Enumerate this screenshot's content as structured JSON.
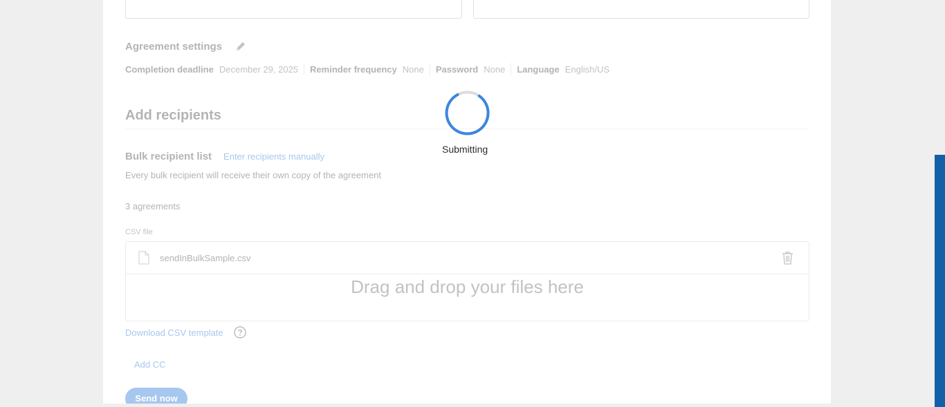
{
  "agreement_settings": {
    "title": "Agreement settings",
    "items": [
      {
        "key": "Completion deadline",
        "value": "December 29, 2025"
      },
      {
        "key": "Reminder frequency",
        "value": "None"
      },
      {
        "key": "Password",
        "value": "None"
      },
      {
        "key": "Language",
        "value": "English/US"
      }
    ]
  },
  "recipients": {
    "title": "Add recipients",
    "bulk_label": "Bulk recipient list",
    "manual_link": "Enter recipients manually",
    "description": "Every bulk recipient will receive their own copy of the agreement",
    "agreements_count": "3 agreements",
    "csv_label": "CSV file",
    "file_name": "sendInBulkSample.csv",
    "drop_text": "Drag and drop your files here",
    "download_link": "Download CSV template",
    "add_cc": "Add CC",
    "send_button": "Send now"
  },
  "overlay": {
    "status": "Submitting"
  },
  "icons": {
    "edit": "pencil-icon",
    "file": "file-icon",
    "delete": "trash-icon",
    "help": "question-circle-icon",
    "loading": "spinner-icon"
  },
  "colors": {
    "accent": "#2d7ad6",
    "spinner": "#3b87e0",
    "side_bar": "#1460a8"
  }
}
